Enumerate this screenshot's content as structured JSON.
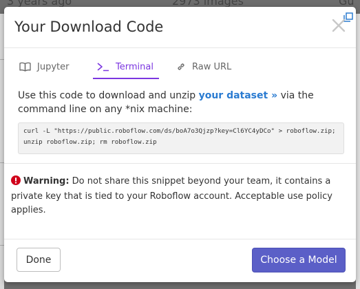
{
  "background": {
    "row_texts": [
      "3 years ago",
      "2973 images",
      "Gu"
    ]
  },
  "modal": {
    "title": "Your Download Code",
    "tabs": [
      {
        "label": "Jupyter",
        "icon": "book-open-icon",
        "active": false
      },
      {
        "label": "Terminal",
        "icon": "terminal-icon",
        "active": true
      },
      {
        "label": "Raw URL",
        "icon": "link-icon",
        "active": false
      }
    ],
    "description": {
      "prefix": "Use this code to download and unzip ",
      "link": "your dataset",
      "link_suffix": "»",
      "suffix": " via the command line on any *nix machine:"
    },
    "code": "curl -L \"https://public.roboflow.com/ds/boA7o3Qjzp?key=Cl6YC4yDCo\" > roboflow.zip;\nunzip roboflow.zip; rm roboflow.zip",
    "warning": {
      "label": "Warning:",
      "text": " Do not share this snippet beyond your team, it contains a private key that is tied to your Roboflow account. Acceptable use policy applies."
    },
    "buttons": {
      "done": "Done",
      "primary": "Choose a Model"
    }
  },
  "colors": {
    "accent": "#7b36e0",
    "link": "#2a7bd1",
    "primary_button": "#5b5fc7",
    "warning_icon": "#d0021b"
  }
}
